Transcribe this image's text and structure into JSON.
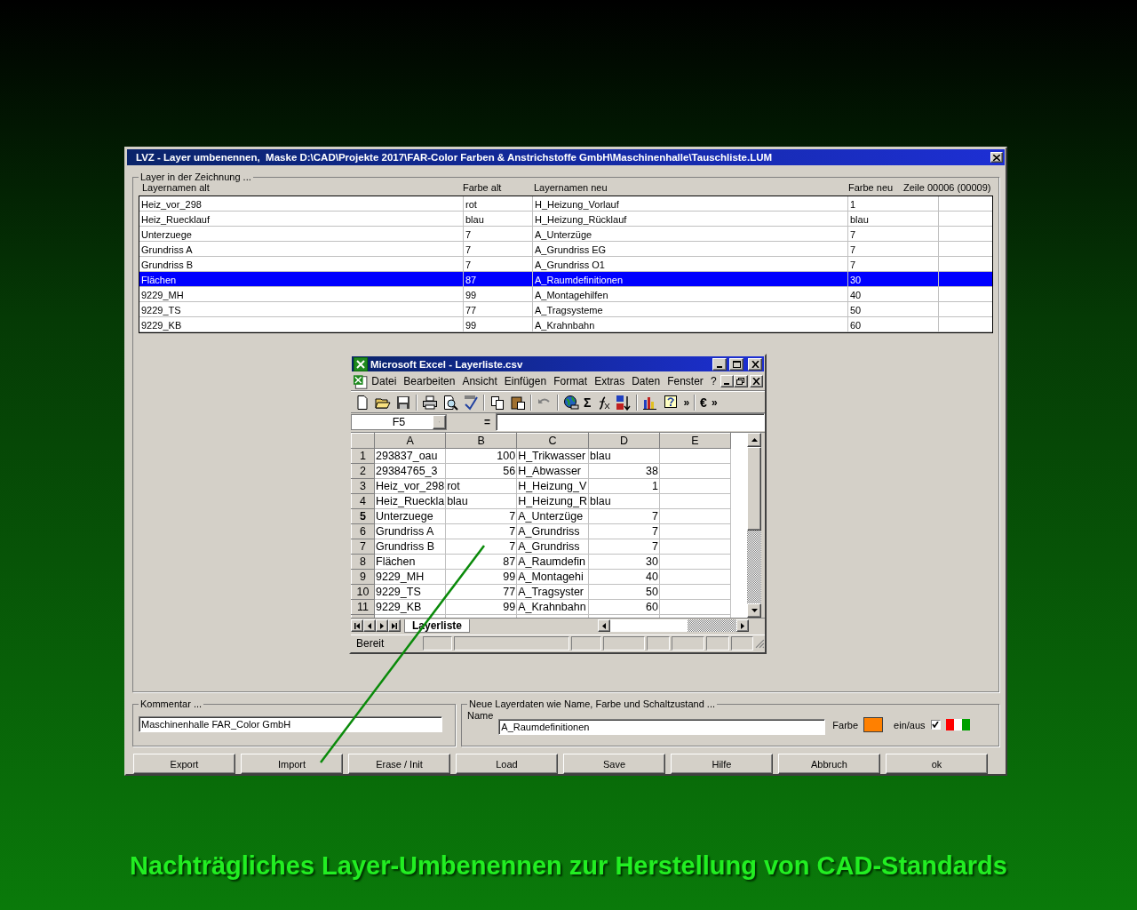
{
  "dialog": {
    "title": "LVZ - Layer umbenennen,  Maske D:\\CAD\\Projekte 2017\\FAR-Color Farben & Anstrichstoffe GmbH\\Maschinenhalle\\Tauschliste.LUM",
    "group_title": "Layer in der Zeichnung ...",
    "columns": [
      "Layernamen alt",
      "Farbe alt",
      "Layernamen neu",
      "Farbe neu"
    ],
    "row_counter": "Zeile 00006 (00009)",
    "rows": [
      {
        "cells": [
          "Heiz_vor_298",
          "rot",
          "H_Heizung_Vorlauf",
          "1"
        ],
        "selected": false
      },
      {
        "cells": [
          "Heiz_Ruecklauf",
          "blau",
          "H_Heizung_Rücklauf",
          "blau"
        ],
        "selected": false
      },
      {
        "cells": [
          "Unterzuege",
          "7",
          "A_Unterzüge",
          "7"
        ],
        "selected": false
      },
      {
        "cells": [
          "Grundriss A",
          "7",
          "A_Grundriss EG",
          "7"
        ],
        "selected": false
      },
      {
        "cells": [
          "Grundriss B",
          "7",
          "A_Grundriss O1",
          "7"
        ],
        "selected": false
      },
      {
        "cells": [
          "Flächen",
          "87",
          "A_Raumdefinitionen",
          "30"
        ],
        "selected": true
      },
      {
        "cells": [
          "9229_MH",
          "99",
          "A_Montagehilfen",
          "40"
        ],
        "selected": false
      },
      {
        "cells": [
          "9229_TS",
          "77",
          "A_Tragsysteme",
          "50"
        ],
        "selected": false
      },
      {
        "cells": [
          "9229_KB",
          "99",
          "A_Krahnbahn",
          "60"
        ],
        "selected": false
      }
    ],
    "comment": {
      "title": "Kommentar ...",
      "value": "Maschinenhalle FAR_Color GmbH"
    },
    "new_layer": {
      "title": "Neue Layerdaten wie Name, Farbe und Schaltzustand ...",
      "name_label": "Name",
      "name_value": "A_Raumdefinitionen",
      "color_label": "Farbe",
      "color": "#ff8000",
      "onoff_label": "ein/aus",
      "checked": true
    },
    "buttons": [
      "Export",
      "Import",
      "Erase / Init",
      "Load",
      "Save",
      "Hilfe",
      "Abbruch",
      "ok"
    ]
  },
  "excel": {
    "title": "Microsoft Excel - Layerliste.csv",
    "menu": [
      "Datei",
      "Bearbeiten",
      "Ansicht",
      "Einfügen",
      "Format",
      "Extras",
      "Daten",
      "Fenster",
      "?"
    ],
    "toolbar": {
      "sum": "Σ",
      "more": "»",
      "euro": "€"
    },
    "name_box": "F5",
    "formula_sign": "=",
    "columns": [
      "A",
      "B",
      "C",
      "D",
      "E"
    ],
    "rows": [
      {
        "header": "1",
        "selected": false,
        "cells": [
          {
            "text": "293837_oau",
            "kind": "text"
          },
          {
            "text": "100",
            "kind": "number"
          },
          {
            "text": "H_Trikwasser",
            "kind": "text"
          },
          {
            "text": "blau",
            "kind": "text"
          }
        ]
      },
      {
        "header": "2",
        "selected": false,
        "cells": [
          {
            "text": "29384765_3",
            "kind": "text"
          },
          {
            "text": "56",
            "kind": "number"
          },
          {
            "text": "H_Abwasser",
            "kind": "text"
          },
          {
            "text": "38",
            "kind": "number"
          }
        ]
      },
      {
        "header": "3",
        "selected": false,
        "cells": [
          {
            "text": "Heiz_vor_298",
            "kind": "text"
          },
          {
            "text": "rot",
            "kind": "text"
          },
          {
            "text": "H_Heizung_V",
            "kind": "text"
          },
          {
            "text": "1",
            "kind": "number"
          }
        ]
      },
      {
        "header": "4",
        "selected": false,
        "cells": [
          {
            "text": "Heiz_Ruecklа",
            "kind": "text"
          },
          {
            "text": "blau",
            "kind": "text"
          },
          {
            "text": "H_Heizung_R",
            "kind": "text"
          },
          {
            "text": "blau",
            "kind": "text"
          }
        ]
      },
      {
        "header": "5",
        "selected": true,
        "cells": [
          {
            "text": "Unterzuege",
            "kind": "text"
          },
          {
            "text": "7",
            "kind": "number"
          },
          {
            "text": "A_Unterzüge",
            "kind": "text"
          },
          {
            "text": "7",
            "kind": "number"
          }
        ]
      },
      {
        "header": "6",
        "selected": false,
        "cells": [
          {
            "text": "Grundriss A",
            "kind": "text"
          },
          {
            "text": "7",
            "kind": "number"
          },
          {
            "text": "A_Grundriss",
            "kind": "text"
          },
          {
            "text": "7",
            "kind": "number"
          }
        ]
      },
      {
        "header": "7",
        "selected": false,
        "cells": [
          {
            "text": "Grundriss B",
            "kind": "text"
          },
          {
            "text": "7",
            "kind": "number"
          },
          {
            "text": "A_Grundriss",
            "kind": "text"
          },
          {
            "text": "7",
            "kind": "number"
          }
        ]
      },
      {
        "header": "8",
        "selected": false,
        "cells": [
          {
            "text": "Flächen",
            "kind": "text"
          },
          {
            "text": "87",
            "kind": "number"
          },
          {
            "text": "A_Raumdefin",
            "kind": "text"
          },
          {
            "text": "30",
            "kind": "number"
          }
        ]
      },
      {
        "header": "9",
        "selected": false,
        "cells": [
          {
            "text": "9229_MH",
            "kind": "text"
          },
          {
            "text": "99",
            "kind": "number"
          },
          {
            "text": "A_Montagehi",
            "kind": "text"
          },
          {
            "text": "40",
            "kind": "number"
          }
        ]
      },
      {
        "header": "10",
        "selected": false,
        "cells": [
          {
            "text": "9229_TS",
            "kind": "text"
          },
          {
            "text": "77",
            "kind": "number"
          },
          {
            "text": "A_Tragsyster",
            "kind": "text"
          },
          {
            "text": "50",
            "kind": "number"
          }
        ]
      },
      {
        "header": "11",
        "selected": false,
        "cells": [
          {
            "text": "9229_KB",
            "kind": "text"
          },
          {
            "text": "99",
            "kind": "number"
          },
          {
            "text": "A_Krahnbahn",
            "kind": "text"
          },
          {
            "text": "60",
            "kind": "number"
          }
        ]
      }
    ],
    "sheet_tab": "Layerliste",
    "status": "Bereit"
  },
  "caption": "Nachträgliches Layer-Umbenennen zur Herstellung von CAD-Standards"
}
